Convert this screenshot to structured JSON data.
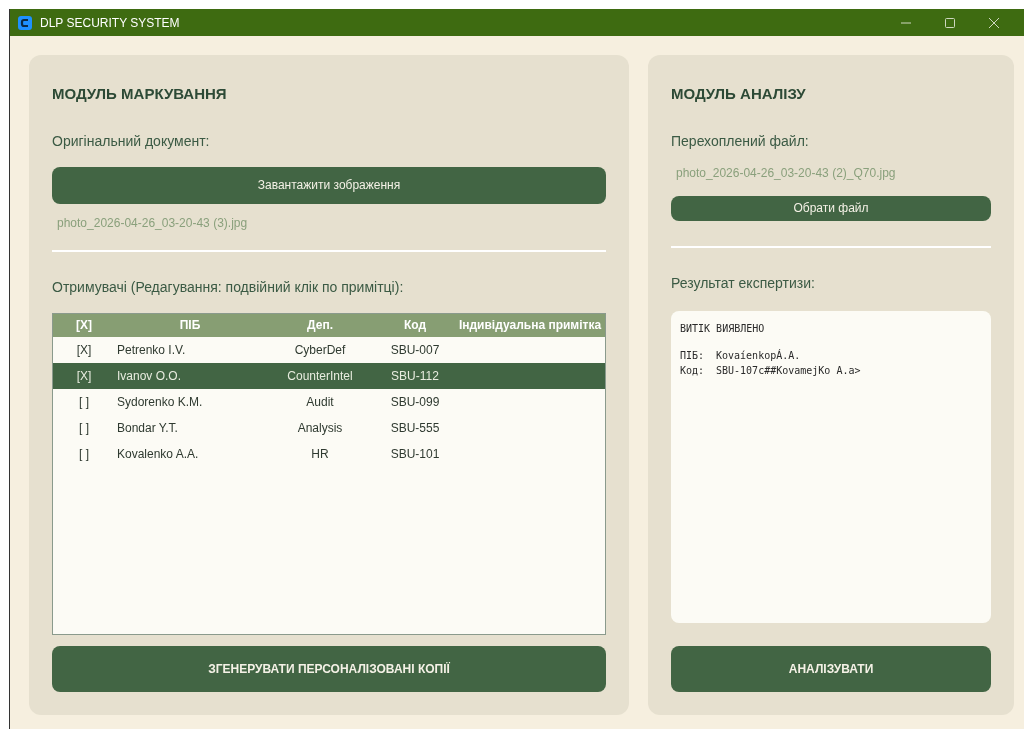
{
  "window": {
    "title": "DLP SECURITY SYSTEM"
  },
  "marking": {
    "title": "МОДУЛЬ МАРКУВАННЯ",
    "doc_label": "Оригінальний документ:",
    "upload_button": "Завантажити зображення",
    "file_name": "photo_2026-04-26_03-20-43 (3).jpg",
    "recipients_label": "Отримувачі (Редагування: подвійний клік по примітці):",
    "table": {
      "columns": [
        "[X]",
        "ПІБ",
        "Деп.",
        "Код",
        "Індивідуальна примітка"
      ],
      "rows": [
        {
          "mark": "[X]",
          "name": "Petrenko I.V.",
          "dept": "CyberDef",
          "code": "SBU-007",
          "selected": false
        },
        {
          "mark": "[X]",
          "name": "Ivanov O.O.",
          "dept": "CounterIntel",
          "code": "SBU-112",
          "selected": true
        },
        {
          "mark": "[ ]",
          "name": "Sydorenko K.M.",
          "dept": "Audit",
          "code": "SBU-099",
          "selected": false
        },
        {
          "mark": "[ ]",
          "name": "Bondar Y.T.",
          "dept": "Analysis",
          "code": "SBU-555",
          "selected": false
        },
        {
          "mark": "[ ]",
          "name": "Kovalenko A.A.",
          "dept": "HR",
          "code": "SBU-101",
          "selected": false
        }
      ]
    },
    "generate_button": "ЗГЕНЕРУВАТИ ПЕРСОНАЛІЗОВАНІ КОПІЇ"
  },
  "analysis": {
    "title": "МОДУЛЬ АНАЛІЗУ",
    "file_label": "Перехоплений файл:",
    "file_name": "photo_2026-04-26_03-20-43 (2)_Q70.jpg",
    "choose_button": "Обрати файл",
    "result_label": "Результат експертизи:",
    "result": {
      "heading": "ВИТІК ВИЯВЛЕНО",
      "fields": [
        {
          "label": "ПІБ:",
          "value": "KovaíenkopÁ.A."
        },
        {
          "label": "Код:",
          "value": "SBU-107c##KovamejKo A.a>"
        }
      ]
    },
    "analyze_button": "АНАЛІЗУВАТИ"
  }
}
